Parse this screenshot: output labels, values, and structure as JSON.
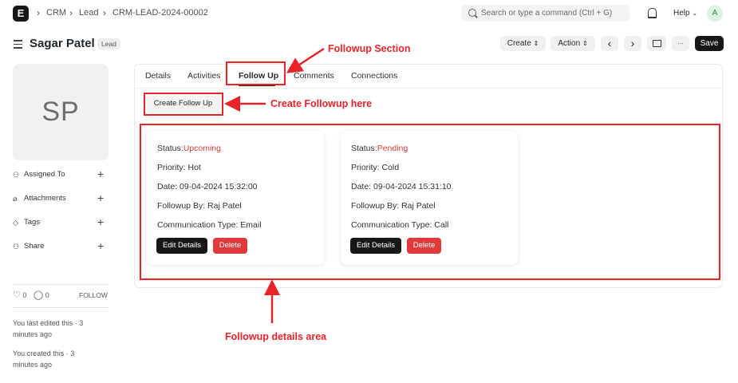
{
  "navbar": {
    "logo": "E",
    "breadcrumbs": [
      "CRM",
      "Lead",
      "CRM-LEAD-2024-00002"
    ],
    "search_placeholder": "Search or type a command (Ctrl + G)",
    "help_label": "Help",
    "user_initial": "A"
  },
  "header": {
    "title": "Sagar Patel",
    "badge": "Lead",
    "create_label": "Create",
    "action_label": "Action",
    "prev_glyph": "‹",
    "next_glyph": "›",
    "more_glyph": "···",
    "save_label": "Save"
  },
  "sidebar": {
    "avatar_initials": "SP",
    "items": [
      {
        "label": "Assigned To",
        "icon": "assign-icon"
      },
      {
        "label": "Attachments",
        "icon": "paperclip-icon"
      },
      {
        "label": "Tags",
        "icon": "tag-icon"
      },
      {
        "label": "Share",
        "icon": "share-icon"
      }
    ],
    "plus_glyph": "+",
    "likes_count": "0",
    "comments_count": "0",
    "follow_label": "FOLLOW",
    "last_edited": "You last edited this · 3 minutes ago",
    "created": "You created this · 3 minutes ago"
  },
  "tabs": [
    "Details",
    "Activities",
    "Follow Up",
    "Comments",
    "Connections"
  ],
  "active_tab": "Follow Up",
  "create_followup_label": "Create Follow Up",
  "followups": [
    {
      "status_label": "Status:",
      "status_value": "Upcoming",
      "priority": "Priority: Hot",
      "date": "Date: 09-04-2024 15:32:00",
      "followup_by": "Followup By: Raj Patel",
      "communication_type": "Communication Type: Email",
      "edit_label": "Edit Details",
      "delete_label": "Delete"
    },
    {
      "status_label": "Status:",
      "status_value": "Pending",
      "priority": "Priority: Cold",
      "date": "Date: 09-04-2024 15:31:10",
      "followup_by": "Followup By: Raj Patel",
      "communication_type": "Communication Type: Call",
      "edit_label": "Edit Details",
      "delete_label": "Delete"
    }
  ],
  "annotations": {
    "followup_section": "Followup Section",
    "create_followup_here": "Create Followup here",
    "followup_details_area": "Followup details area"
  },
  "colors": {
    "annotation_red": "#e8232a",
    "status_red": "#e03a3a",
    "primary_dark": "#171717"
  }
}
